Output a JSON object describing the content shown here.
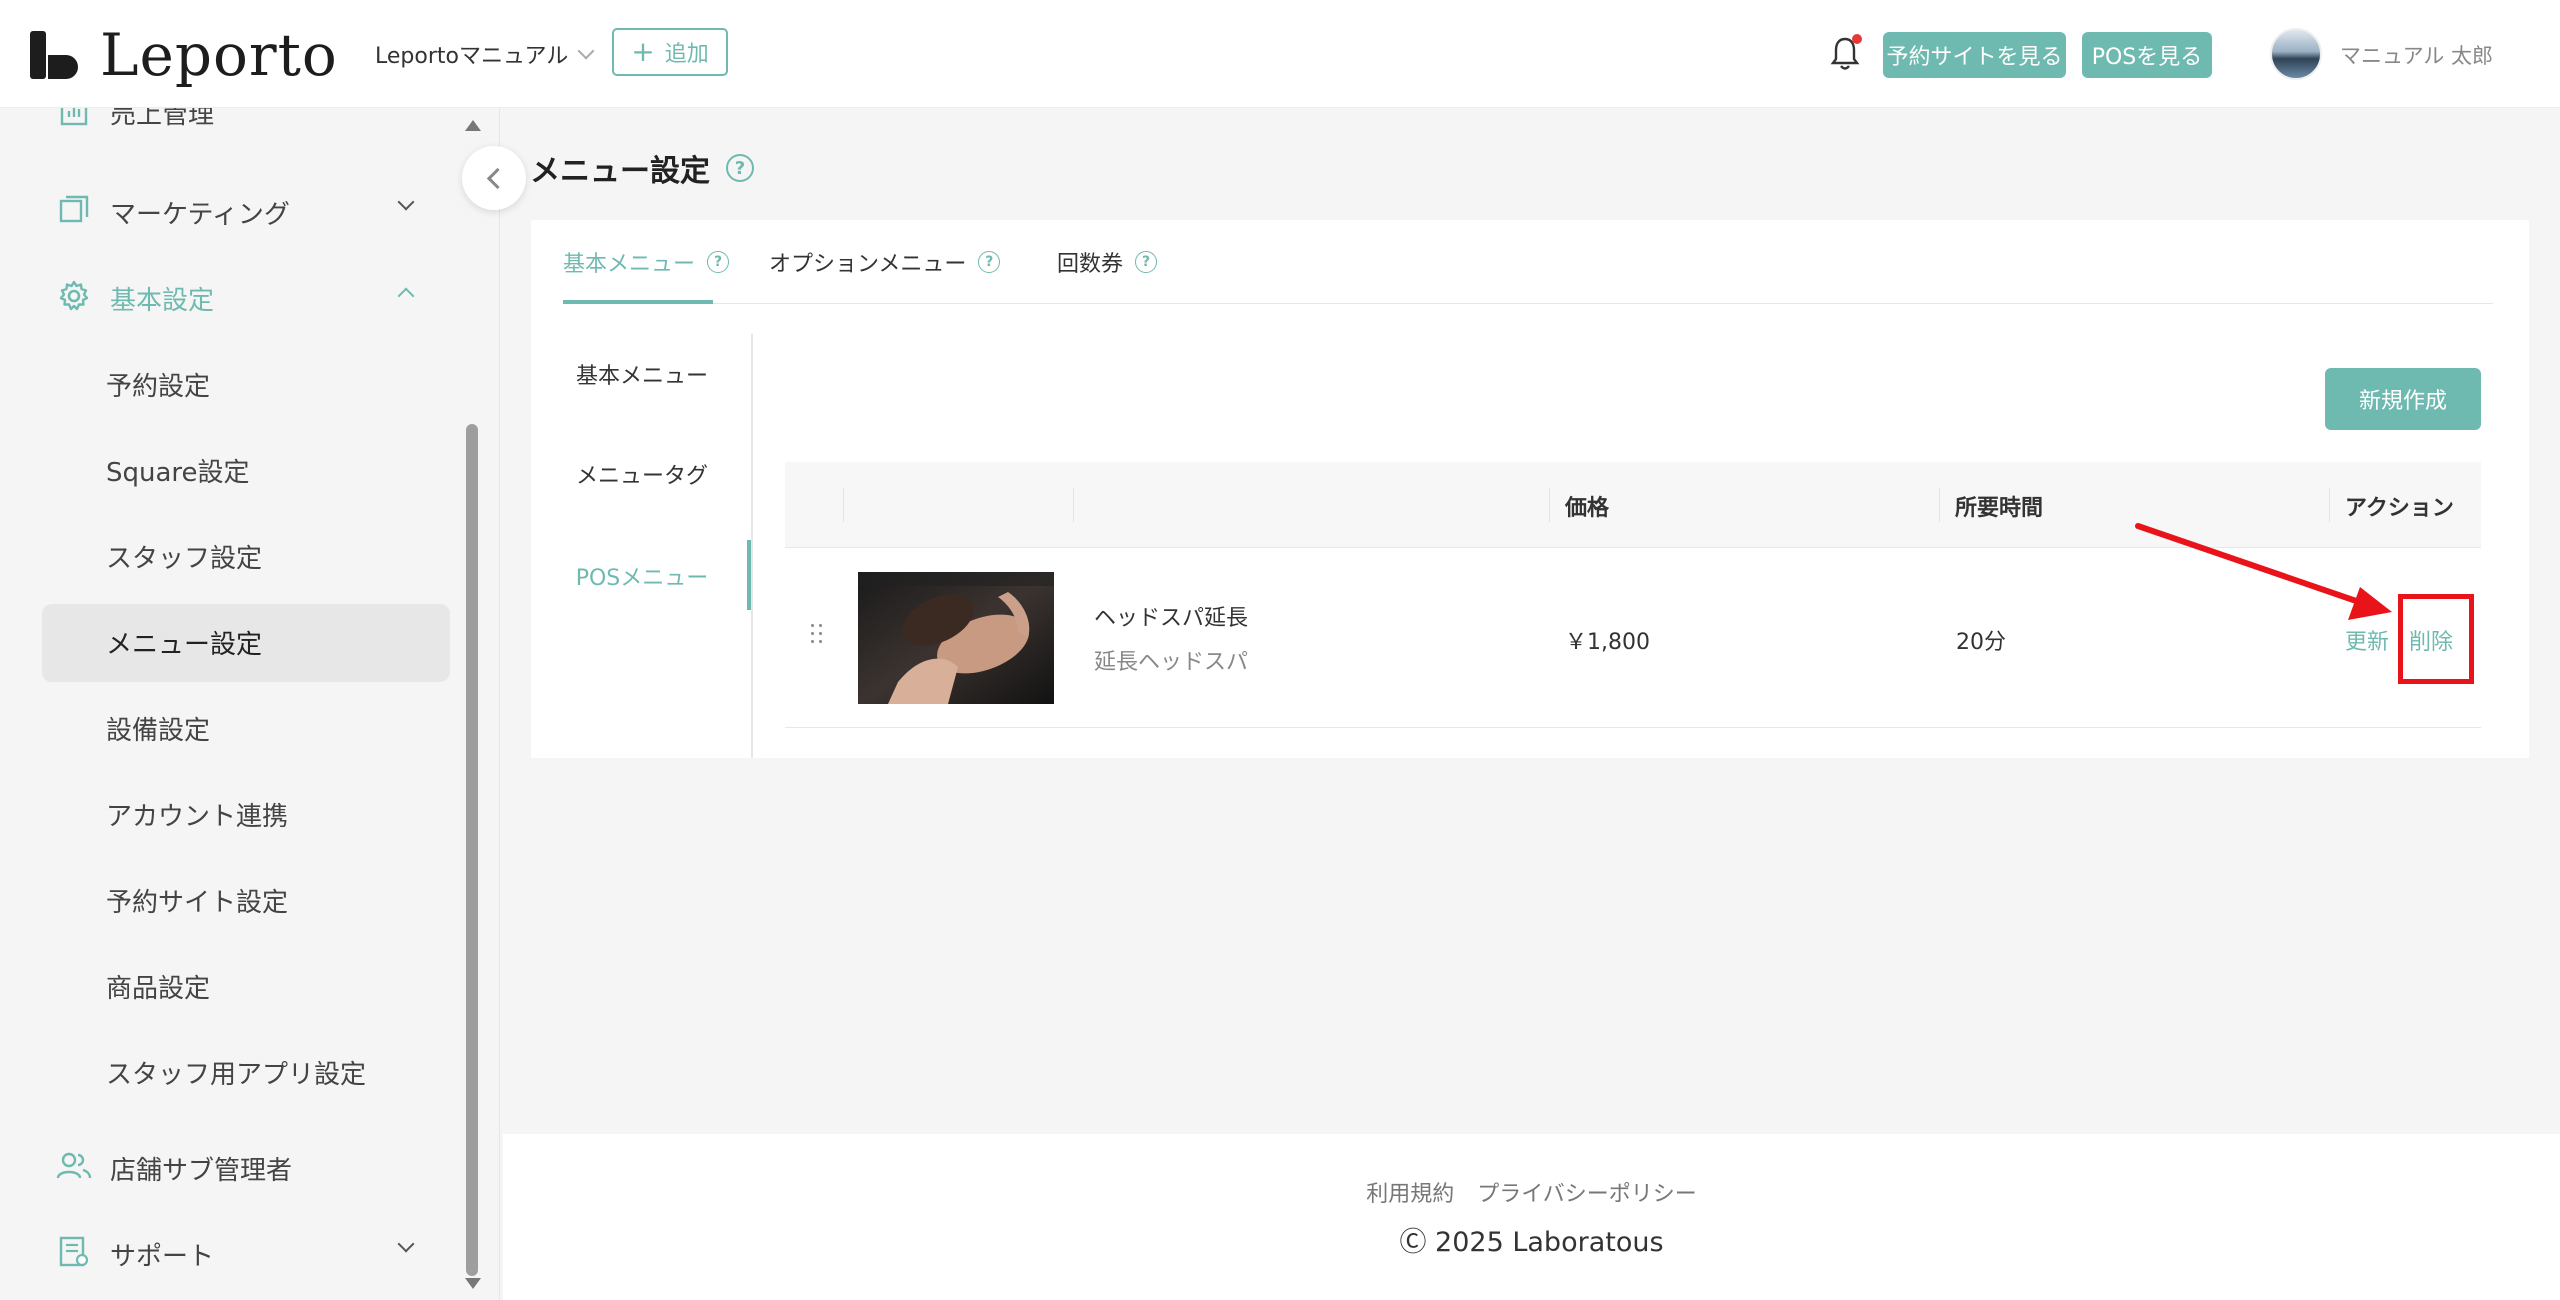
{
  "header": {
    "logo_text": "Leporto",
    "store_name": "Leportoマニュアル",
    "add_label": "追加",
    "add_icon": "plus-icon",
    "view_site_label": "予約サイトを見る",
    "view_pos_label": "POSを見る",
    "user_name": "マニュアル 太郎",
    "notification_icon": "bell-icon"
  },
  "sidebar": {
    "items": [
      {
        "label": "売上管理",
        "icon": "bar-chart-icon"
      },
      {
        "label": "マーケティング",
        "icon": "layers-icon"
      },
      {
        "label": "基本設定",
        "icon": "gear-icon"
      },
      {
        "label": "店舗サブ管理者",
        "icon": "users-icon"
      },
      {
        "label": "サポート",
        "icon": "document-icon"
      }
    ],
    "sub_items": [
      "予約設定",
      "Square設定",
      "スタッフ設定",
      "メニュー設定",
      "設備設定",
      "アカウント連携",
      "予約サイト設定",
      "商品設定",
      "スタッフ用アプリ設定"
    ]
  },
  "main": {
    "title": "メニュー設定",
    "help_glyph": "?",
    "tabs": [
      {
        "label": "基本メニュー"
      },
      {
        "label": "オプションメニュー"
      },
      {
        "label": "回数券"
      }
    ],
    "subnav": [
      "基本メニュー",
      "メニュータグ",
      "POSメニュー"
    ],
    "new_button": "新規作成",
    "columns": {
      "price": "価格",
      "duration": "所要時間",
      "action": "アクション"
    },
    "rows": [
      {
        "name": "ヘッドスパ延長",
        "subtitle": "延長ヘッドスパ",
        "price": "￥1,800",
        "duration": "20分",
        "update": "更新",
        "delete": "削除"
      }
    ]
  },
  "footer": {
    "links": [
      "利用規約",
      "プライバシーポリシー"
    ],
    "copyright": "Ⓒ 2025 Laboratous"
  },
  "colors": {
    "accent": "#6fbab0",
    "highlight": "#e8141a"
  }
}
